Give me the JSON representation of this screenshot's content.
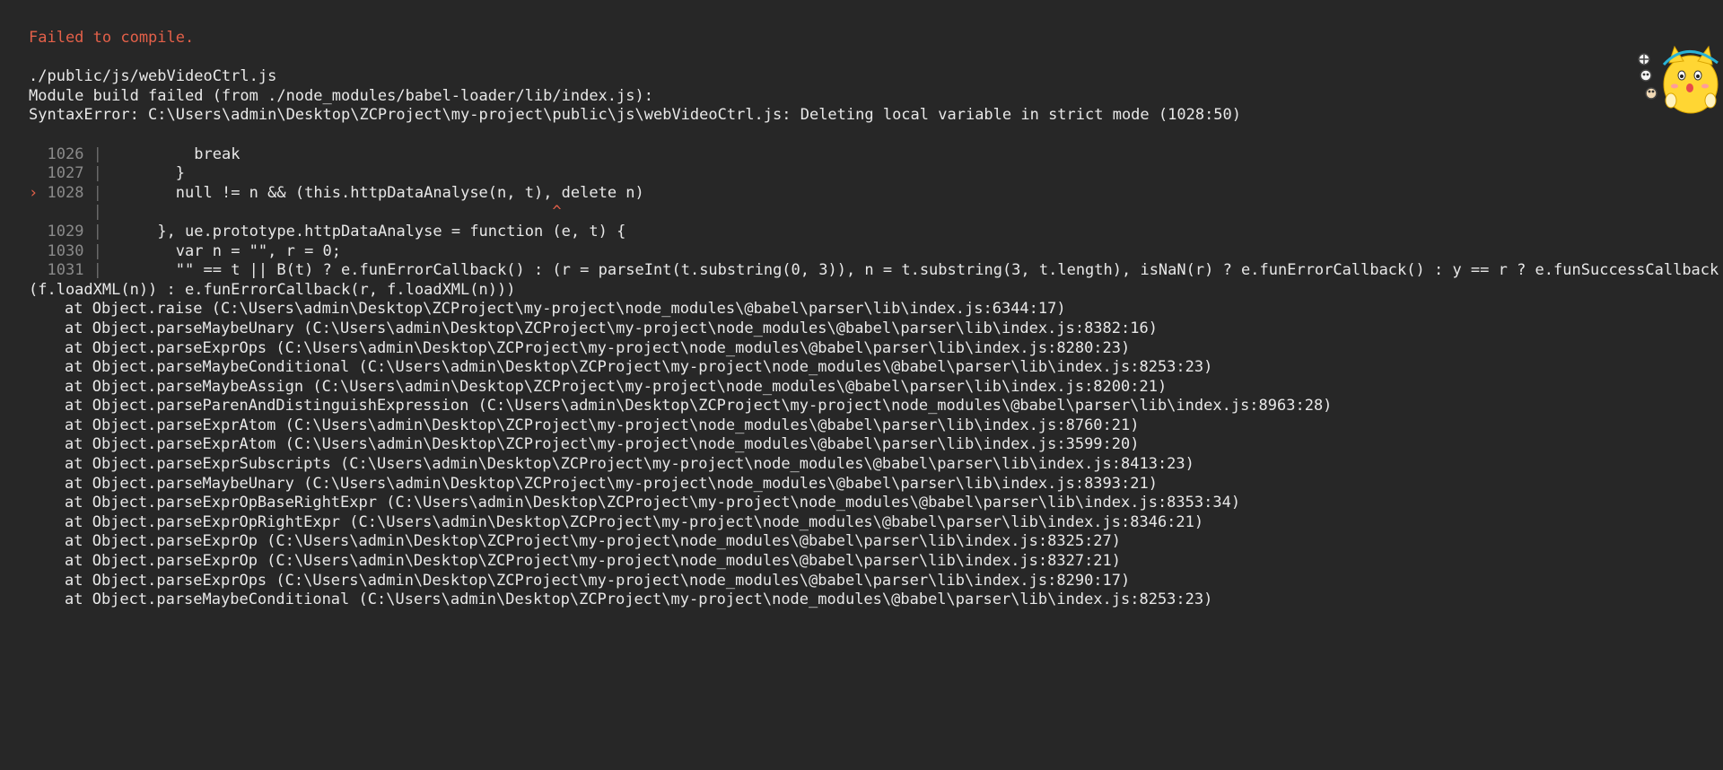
{
  "title": "Failed to compile.",
  "error": {
    "file": "./public/js/webVideoCtrl.js",
    "build_failed": "Module build failed (from ./node_modules/babel-loader/lib/index.js):",
    "syntax_error": "SyntaxError: C:\\Users\\admin\\Desktop\\ZCProject\\my-project\\public\\js\\webVideoCtrl.js: Deleting local variable in strict mode (1028:50)"
  },
  "code_frame": [
    {
      "pointer": " ",
      "lineno": "1026",
      "gutter": "|",
      "code": "          break"
    },
    {
      "pointer": " ",
      "lineno": "1027",
      "gutter": "|",
      "code": "        }"
    },
    {
      "pointer": ">",
      "lineno": "1028",
      "gutter": "|",
      "code": "        null != n && (this.httpDataAnalyse(n, t), delete n)"
    },
    {
      "pointer": " ",
      "lineno": "    ",
      "gutter": "|",
      "code": "                                                 ^"
    },
    {
      "pointer": " ",
      "lineno": "1029",
      "gutter": "|",
      "code": "      }, ue.prototype.httpDataAnalyse = function (e, t) {"
    },
    {
      "pointer": " ",
      "lineno": "1030",
      "gutter": "|",
      "code": "        var n = \"\", r = 0;"
    },
    {
      "pointer": " ",
      "lineno": "1031",
      "gutter": "|",
      "code": "        \"\" == t || B(t) ? e.funErrorCallback() : (r = parseInt(t.substring(0, 3)), n = t.substring(3, t.length), isNaN(r) ? e.funErrorCallback() : y == r ? e.funSuccessCallback"
    }
  ],
  "continuation": "(f.loadXML(n)) : e.funErrorCallback(r, f.loadXML(n)))",
  "stack": [
    "at Object.raise (C:\\Users\\admin\\Desktop\\ZCProject\\my-project\\node_modules\\@babel\\parser\\lib\\index.js:6344:17)",
    "at Object.parseMaybeUnary (C:\\Users\\admin\\Desktop\\ZCProject\\my-project\\node_modules\\@babel\\parser\\lib\\index.js:8382:16)",
    "at Object.parseExprOps (C:\\Users\\admin\\Desktop\\ZCProject\\my-project\\node_modules\\@babel\\parser\\lib\\index.js:8280:23)",
    "at Object.parseMaybeConditional (C:\\Users\\admin\\Desktop\\ZCProject\\my-project\\node_modules\\@babel\\parser\\lib\\index.js:8253:23)",
    "at Object.parseMaybeAssign (C:\\Users\\admin\\Desktop\\ZCProject\\my-project\\node_modules\\@babel\\parser\\lib\\index.js:8200:21)",
    "at Object.parseParenAndDistinguishExpression (C:\\Users\\admin\\Desktop\\ZCProject\\my-project\\node_modules\\@babel\\parser\\lib\\index.js:8963:28)",
    "at Object.parseExprAtom (C:\\Users\\admin\\Desktop\\ZCProject\\my-project\\node_modules\\@babel\\parser\\lib\\index.js:8760:21)",
    "at Object.parseExprAtom (C:\\Users\\admin\\Desktop\\ZCProject\\my-project\\node_modules\\@babel\\parser\\lib\\index.js:3599:20)",
    "at Object.parseExprSubscripts (C:\\Users\\admin\\Desktop\\ZCProject\\my-project\\node_modules\\@babel\\parser\\lib\\index.js:8413:23)",
    "at Object.parseMaybeUnary (C:\\Users\\admin\\Desktop\\ZCProject\\my-project\\node_modules\\@babel\\parser\\lib\\index.js:8393:21)",
    "at Object.parseExprOpBaseRightExpr (C:\\Users\\admin\\Desktop\\ZCProject\\my-project\\node_modules\\@babel\\parser\\lib\\index.js:8353:34)",
    "at Object.parseExprOpRightExpr (C:\\Users\\admin\\Desktop\\ZCProject\\my-project\\node_modules\\@babel\\parser\\lib\\index.js:8346:21)",
    "at Object.parseExprOp (C:\\Users\\admin\\Desktop\\ZCProject\\my-project\\node_modules\\@babel\\parser\\lib\\index.js:8325:27)",
    "at Object.parseExprOp (C:\\Users\\admin\\Desktop\\ZCProject\\my-project\\node_modules\\@babel\\parser\\lib\\index.js:8327:21)",
    "at Object.parseExprOps (C:\\Users\\admin\\Desktop\\ZCProject\\my-project\\node_modules\\@babel\\parser\\lib\\index.js:8290:17)",
    "at Object.parseMaybeConditional (C:\\Users\\admin\\Desktop\\ZCProject\\my-project\\node_modules\\@babel\\parser\\lib\\index.js:8253:23)"
  ],
  "mascot": {
    "icon": "cat-mascot-icon"
  },
  "colors": {
    "background": "#272727",
    "error_title": "#e36049",
    "text": "#e8e8e8"
  }
}
